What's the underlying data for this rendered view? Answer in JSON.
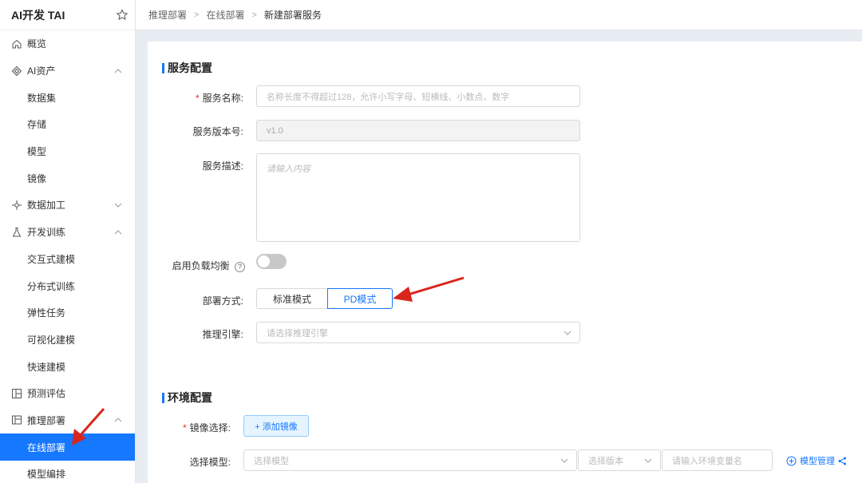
{
  "sidebar": {
    "brand": "AI开发 TAI",
    "items": [
      {
        "label": "概览",
        "icon": "home-icon"
      },
      {
        "label": "AI资产",
        "icon": "diamond-icon",
        "expanded": true
      },
      {
        "label": "数据集",
        "sub": true
      },
      {
        "label": "存储",
        "sub": true
      },
      {
        "label": "模型",
        "sub": true
      },
      {
        "label": "镜像",
        "sub": true
      },
      {
        "label": "数据加工",
        "icon": "cross-icon",
        "expanded": false
      },
      {
        "label": "开发训练",
        "icon": "flask-icon",
        "expanded": true
      },
      {
        "label": "交互式建模",
        "sub": true
      },
      {
        "label": "分布式训练",
        "sub": true
      },
      {
        "label": "弹性任务",
        "sub": true
      },
      {
        "label": "可视化建模",
        "sub": true
      },
      {
        "label": "快速建模",
        "sub": true
      },
      {
        "label": "预测评估",
        "icon": "layout-icon"
      },
      {
        "label": "推理部署",
        "icon": "deploy-icon",
        "expanded": true
      },
      {
        "label": "在线部署",
        "sub": true,
        "active": true
      },
      {
        "label": "模型编排",
        "sub": true
      }
    ]
  },
  "breadcrumb": [
    "推理部署",
    "在线部署",
    "新建部署服务"
  ],
  "service_config": {
    "title": "服务配置",
    "name_label": "服务名称:",
    "name_placeholder": "名称长度不得超过128，允许小写字母、短横线、小数点、数字",
    "version_label": "服务版本号:",
    "version_value": "v1.0",
    "desc_label": "服务描述:",
    "desc_placeholder": "请输入内容",
    "lb_label": "启用负载均衡",
    "lb_enabled": false,
    "deploy_mode_label": "部署方式:",
    "deploy_modes": [
      "标准模式",
      "PD模式"
    ],
    "deploy_mode_selected": "PD模式",
    "engine_label": "推理引擎:",
    "engine_placeholder": "请选择推理引擎"
  },
  "env_config": {
    "title": "环境配置",
    "image_label": "镜像选择:",
    "add_image": "+ 添加镜像",
    "model_label": "选择模型:",
    "model_placeholder": "选择模型",
    "version_placeholder": "选择版本",
    "env_placeholder": "请输入环境变量名",
    "model_manage": "模型管理"
  },
  "colors": {
    "accent": "#1677ff",
    "annotation_arrow": "#d9261c"
  }
}
